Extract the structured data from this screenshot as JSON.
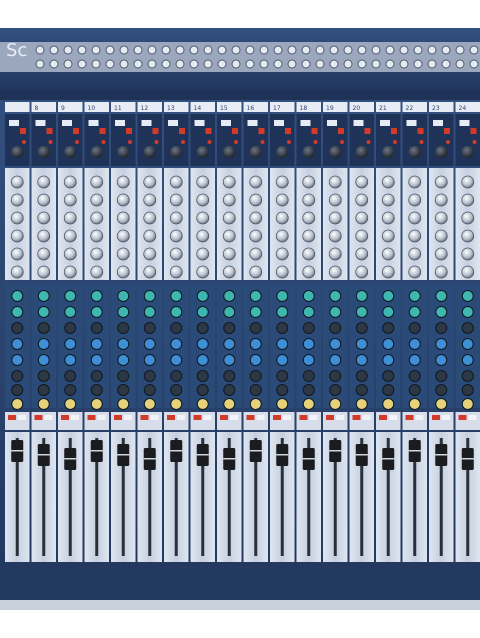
{
  "photo": {
    "subject": "mixing-console",
    "brand_mark": "Sc",
    "channel_numbers": [
      "8",
      "9",
      "10",
      "11",
      "12",
      "13",
      "14",
      "15",
      "16",
      "17",
      "18",
      "19",
      "20",
      "21",
      "22",
      "23",
      "24"
    ],
    "colors": {
      "chassis": "#2d4470",
      "chassis_dark": "#1f3358",
      "panel_light": "#cfd8e6",
      "panel_mid": "#b9c4d6",
      "eq_band": "#2a4a78",
      "mute_red": "#d23a2a",
      "knob_teal": "#3fb6b0",
      "knob_blue": "#3f8fd6",
      "knob_yellow": "#e6d27a",
      "fader_slot": "#2b2f36",
      "fader_cap": "#1a1c20",
      "background": "#ffffff"
    }
  }
}
